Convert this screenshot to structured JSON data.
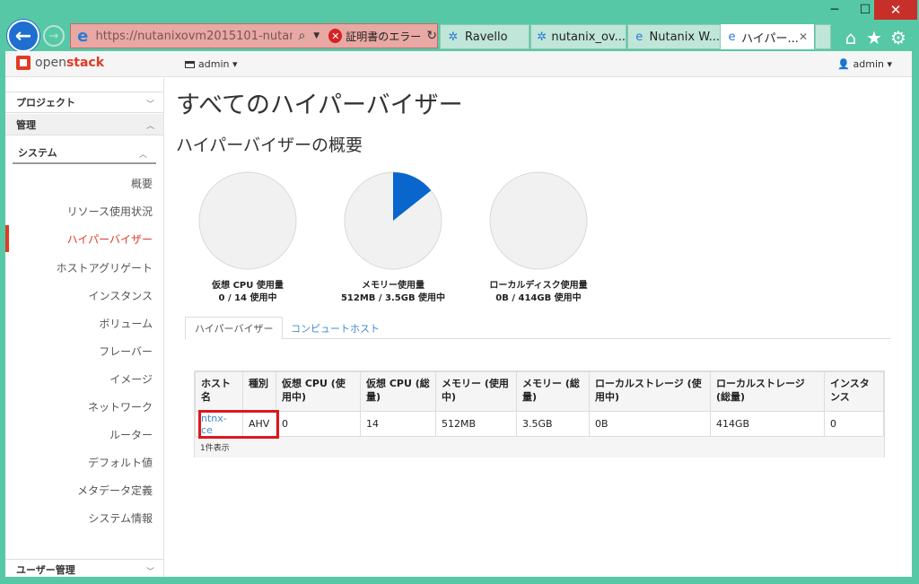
{
  "browser": {
    "window_controls": {
      "minimize": "─",
      "maximize": "☐",
      "close": "✕"
    },
    "address_url": "https://nutanixovm2015101-nutan...",
    "cert_error": "証明書のエラー",
    "tabs": [
      {
        "label": "Ravello"
      },
      {
        "label": "nutanix_ov..."
      },
      {
        "label": "Nutanix W..."
      },
      {
        "label": "ハイパー..."
      }
    ]
  },
  "topbar": {
    "logo_open": "open",
    "logo_stack": "stack",
    "project_menu": "admin ▾",
    "user_menu": "👤 admin ▾"
  },
  "sidebar": {
    "project": "プロジェクト",
    "admin": "管理",
    "system": "システム",
    "items": [
      {
        "label": "概要"
      },
      {
        "label": "リソース使用状況"
      },
      {
        "label": "ハイパーバイザー"
      },
      {
        "label": "ホストアグリゲート"
      },
      {
        "label": "インスタンス"
      },
      {
        "label": "ボリューム"
      },
      {
        "label": "フレーバー"
      },
      {
        "label": "イメージ"
      },
      {
        "label": "ネットワーク"
      },
      {
        "label": "ルーター"
      },
      {
        "label": "デフォルト値"
      },
      {
        "label": "メタデータ定義"
      },
      {
        "label": "システム情報"
      }
    ],
    "user_mgmt": "ユーザー管理"
  },
  "main": {
    "title": "すべてのハイパーバイザー",
    "summary_title": "ハイパーバイザーの概要",
    "pies": [
      {
        "label": "仮想 CPU 使用量",
        "detail": "0 / 14 使用中",
        "used_fraction": 0
      },
      {
        "label": "メモリー使用量",
        "detail": "512MB / 3.5GB 使用中",
        "used_fraction": 0.143
      },
      {
        "label": "ローカルディスク使用量",
        "detail": "0B / 414GB 使用中",
        "used_fraction": 0
      }
    ],
    "tabs": [
      "ハイパーバイザー",
      "コンピュートホスト"
    ],
    "table": {
      "headers": [
        "ホスト名",
        "種別",
        "仮想 CPU (使用中)",
        "仮想 CPU (総量)",
        "メモリー (使用中)",
        "メモリー (総量)",
        "ローカルストレージ (使用中)",
        "ローカルストレージ (総量)",
        "インスタンス"
      ],
      "rows": [
        [
          "ntnx-ce",
          "AHV",
          "0",
          "14",
          "512MB",
          "3.5GB",
          "0B",
          "414GB",
          "0"
        ]
      ],
      "footer": "1件表示"
    }
  },
  "colors": {
    "accent": "#e03b24",
    "link": "#428bca",
    "pie_fill": "#0866cc",
    "pie_bg": "#f1f1f1",
    "highlight_box": "#e0161e"
  }
}
